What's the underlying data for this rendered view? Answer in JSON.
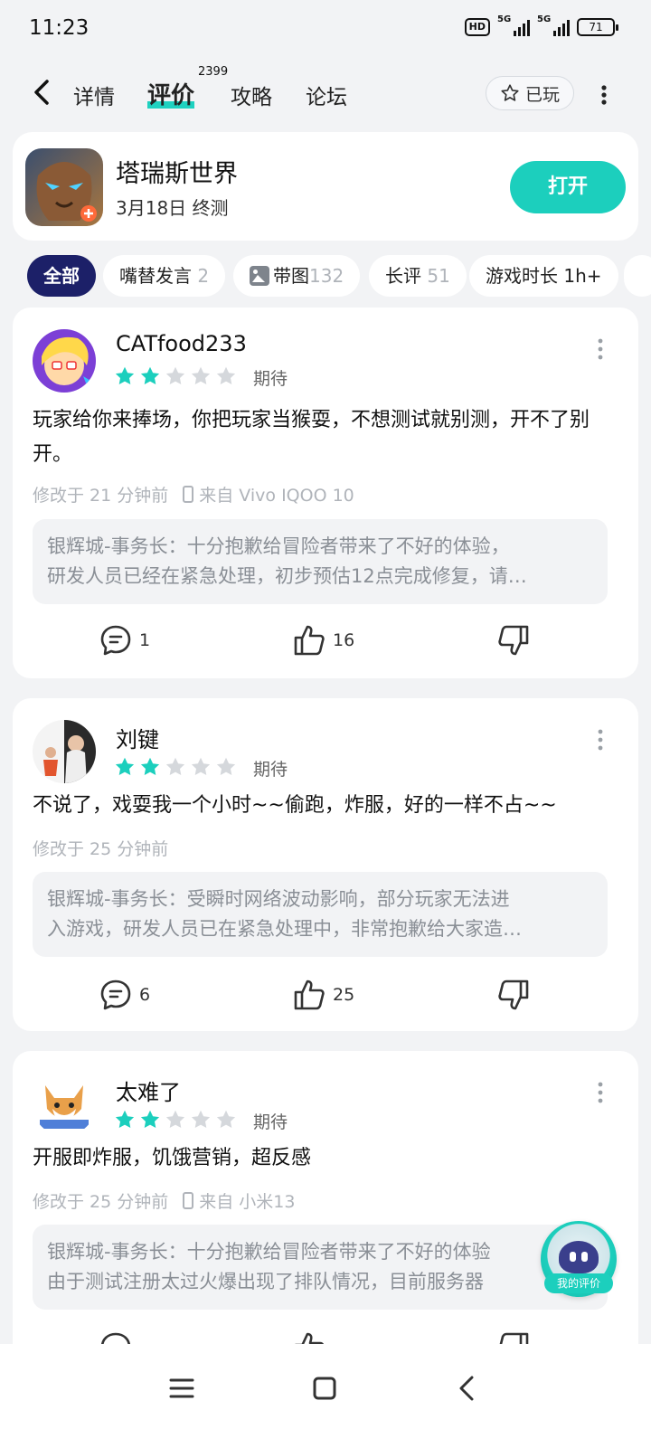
{
  "status_bar": {
    "time": "11:23",
    "hd_label": "HD",
    "net1": "5G",
    "net2": "5G",
    "battery": "71"
  },
  "nav": {
    "tabs": [
      {
        "label": "详情"
      },
      {
        "label": "评价",
        "count": "2399"
      },
      {
        "label": "攻略"
      },
      {
        "label": "论坛"
      }
    ],
    "played_label": "已玩"
  },
  "game": {
    "name": "塔瑞斯世界",
    "sub": "3月18日 终测",
    "open_label": "打开"
  },
  "filters": [
    {
      "label": "全部",
      "count": ""
    },
    {
      "label": "嘴替发言",
      "count": "2"
    },
    {
      "label": "带图",
      "count": "132"
    },
    {
      "label": "长评",
      "count": "51"
    },
    {
      "label": "游戏时长 1h+",
      "count": ""
    }
  ],
  "reviews": [
    {
      "user": "CATfood233",
      "rating": 2,
      "expect": "期待",
      "text": "玩家给你来捧场，你把玩家当猴耍，不想测试就别测，开不了别开。",
      "time": "修改于 21 分钟前",
      "device": "来自 Vivo IQOO 10",
      "reply_line1": "银辉城-事务长：十分抱歉给冒险者带来了不好的体验，",
      "reply_line2": "研发人员已经在紧急处理，初步预估12点完成修复，请…",
      "comments": "1",
      "likes": "16"
    },
    {
      "user": "刘键",
      "rating": 2,
      "expect": "期待",
      "text": "不说了，戏耍我一个小时~~偷跑，炸服，好的一样不占~~",
      "time": "修改于 25 分钟前",
      "device": "",
      "reply_line1": "银辉城-事务长：受瞬时网络波动影响，部分玩家无法进",
      "reply_line2": "入游戏，研发人员已在紧急处理中，非常抱歉给大家造…",
      "comments": "6",
      "likes": "25"
    },
    {
      "user": "太难了",
      "rating": 2,
      "expect": "期待",
      "text": "开服即炸服，饥饿营销，超反感",
      "time": "修改于 25 分钟前",
      "device": "来自 小米13",
      "reply_line1": "银辉城-事务长：十分抱歉给冒险者带来了不好的体验",
      "reply_line2": "由于测试注册太过火爆出现了排队情况，目前服务器",
      "comments": "",
      "likes": ""
    }
  ],
  "my_review_label": "我的评价",
  "colors": {
    "accent": "#1ccfbd",
    "chip_active": "#1c2068",
    "star_off": "#d5d8dc"
  }
}
